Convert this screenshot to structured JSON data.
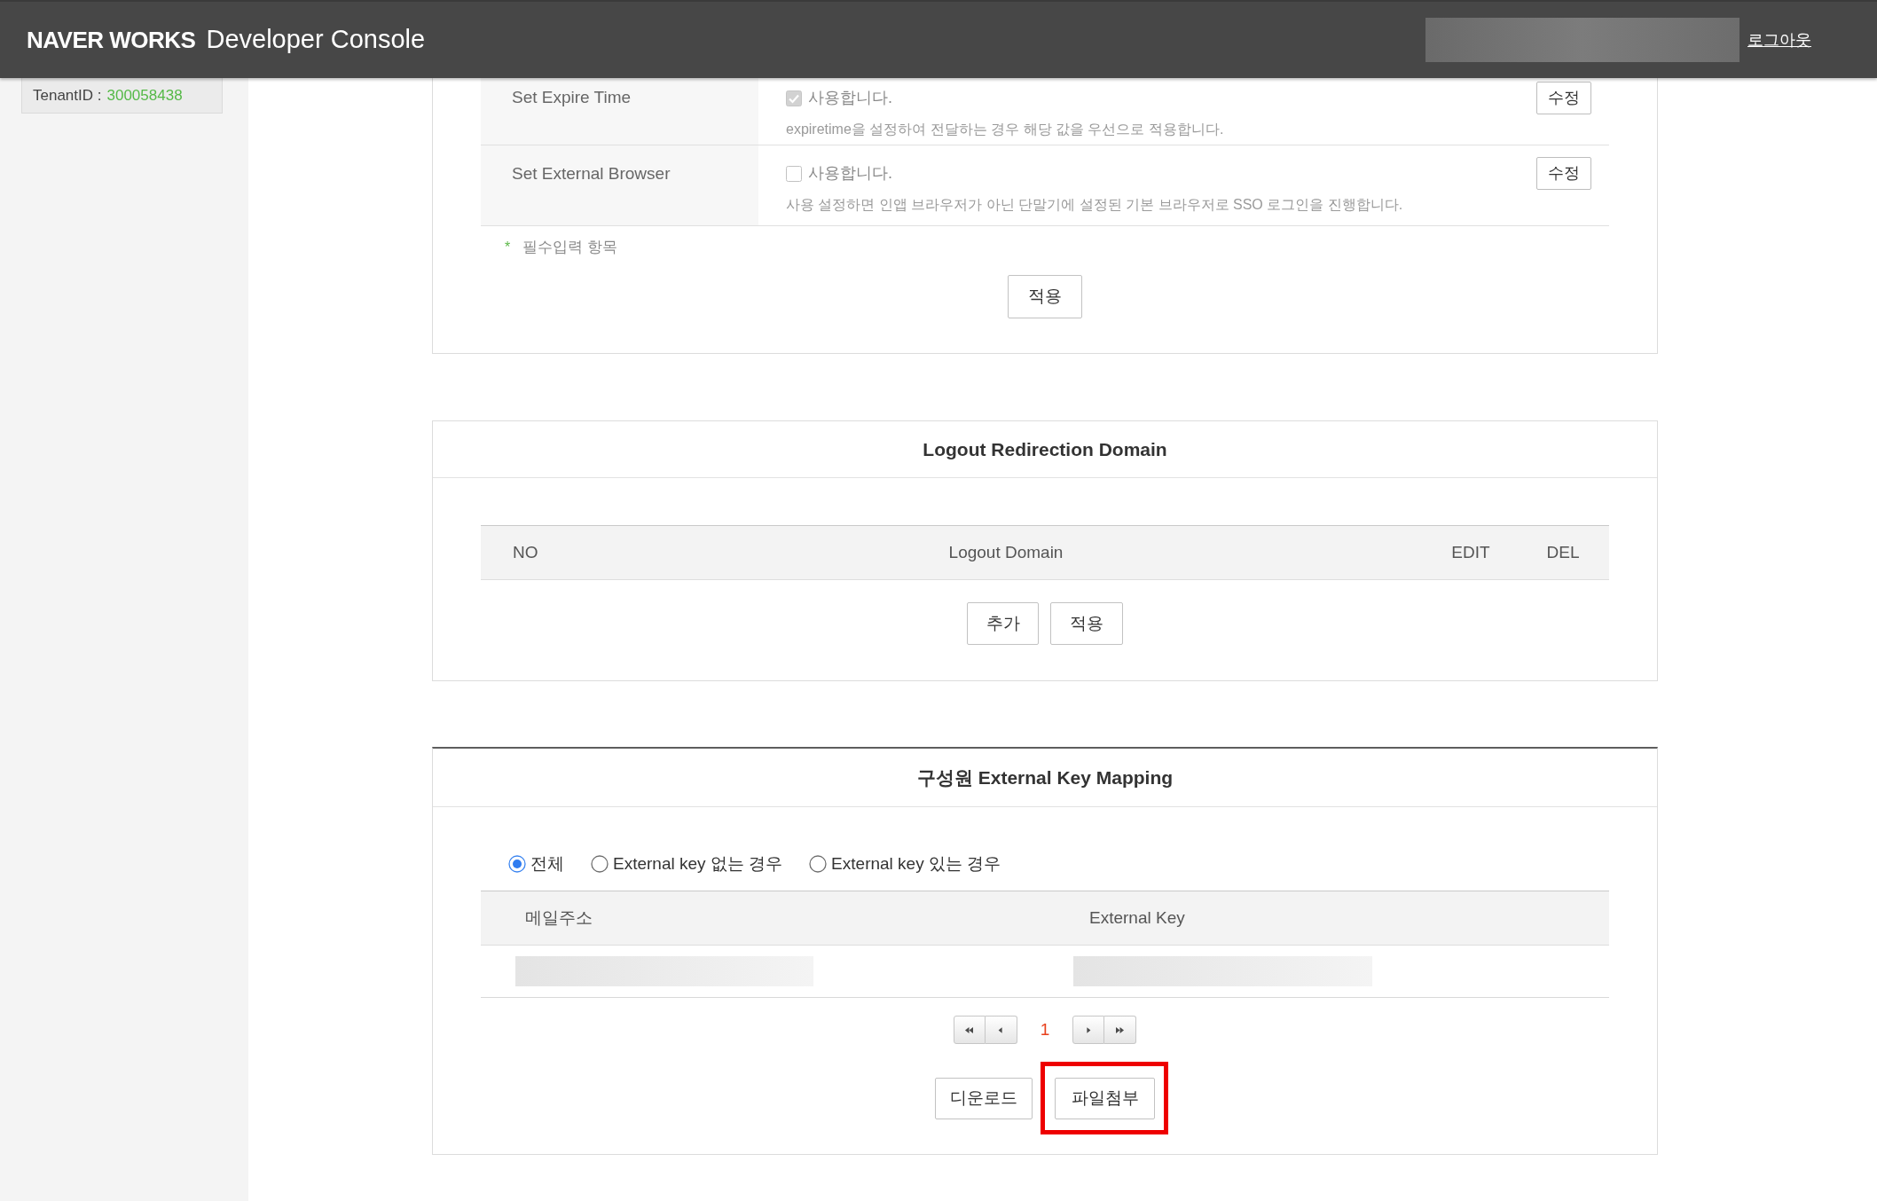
{
  "header": {
    "brand": "NAVER WORKS",
    "title": "Developer Console",
    "logout_link": "로그아웃"
  },
  "sidebar": {
    "tenant_label": "TenantID :",
    "tenant_id": "300058438"
  },
  "settings": {
    "rows": [
      {
        "label": "Set Expire Time",
        "checkbox_label": "사용합니다.",
        "checked": true,
        "description": "expiretime을 설정하여 전달하는 경우 해당 값을 우선으로 적용합니다.",
        "edit_button": "수정"
      },
      {
        "label": "Set External Browser",
        "checkbox_label": "사용합니다.",
        "checked": false,
        "description": "사용 설정하면 인앱 브라우저가 아닌 단말기에 설정된 기본 브라우저로 SSO 로그인을 진행합니다.",
        "edit_button": "수정"
      }
    ],
    "required_mark": "*",
    "required_note": "필수입력 항목",
    "apply_button": "적용"
  },
  "logout_domain": {
    "title": "Logout Redirection Domain",
    "columns": [
      "NO",
      "Logout Domain",
      "EDIT",
      "DEL"
    ],
    "add_button": "추가",
    "apply_button": "적용"
  },
  "key_mapping": {
    "title": "구성원 External Key Mapping",
    "filters": [
      {
        "label": "전체",
        "selected": true
      },
      {
        "label": "External key 없는 경우",
        "selected": false
      },
      {
        "label": "External key 있는 경우",
        "selected": false
      }
    ],
    "columns": [
      "메일주소",
      "External Key"
    ],
    "pages": [
      {
        "label": "1",
        "selected": true
      }
    ],
    "download_button": {
      "label": "디운로드",
      "highlighted": false
    },
    "attach_button": {
      "label": "파일첨부",
      "highlighted": true
    }
  }
}
